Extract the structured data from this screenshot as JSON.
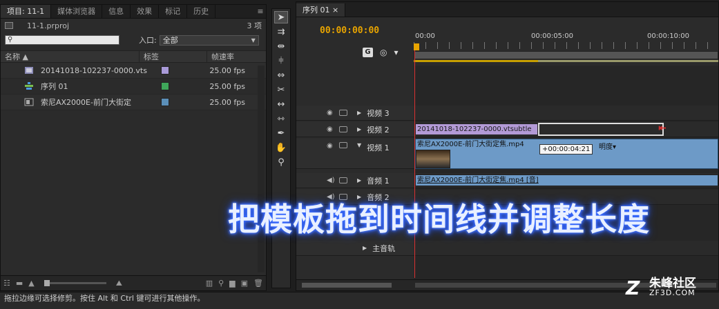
{
  "project_panel": {
    "tabs": [
      "项目: 11-1",
      "媒体浏览器",
      "信息",
      "效果",
      "标记",
      "历史"
    ],
    "file_name": "11-1.prproj",
    "item_count": "3 项",
    "search_placeholder": "",
    "entry_label": "入口:",
    "entry_value": "全部",
    "columns": [
      "名称 ▲",
      "标签",
      "帧速率"
    ],
    "items": [
      {
        "name": "20141018-102237-0000.vts",
        "label_color": "#a99ad8",
        "fps": "25.00 fps",
        "icon": "title-file-icon"
      },
      {
        "name": "序列 01",
        "label_color": "#3fa65a",
        "fps": "25.00 fps",
        "icon": "sequence-icon"
      },
      {
        "name": "索尼AX2000E-前门大街定",
        "label_color": "#5b8fb8",
        "fps": "25.00 fps",
        "icon": "video-clip-icon"
      }
    ]
  },
  "timeline": {
    "tab": "序列 01",
    "timecode": "00:00:00:00",
    "ruler_labels": [
      "00:00",
      "00:00:05:00",
      "00:00:10:00"
    ],
    "tracks": {
      "video3": "视频 3",
      "video2": "视频 2",
      "video1": "视频 1",
      "audio1": "音频 1",
      "audio2": "音频 2",
      "master": "主音轨"
    },
    "clips": {
      "title_clip": "20141018-102237-0000.vtsubtle",
      "video_clip": "索尼AX2000E-前门大街定焦.mp4",
      "opacity": "明度",
      "audio_clip": "索尼AX2000E-前门大街定焦.mp4 [音]"
    },
    "trim_tooltip": "+00:00:04:21"
  },
  "caption": "把模板拖到时间线并调整长度",
  "status_bar": "拖拉边缘可选择修剪。按住 Alt 和 Ctrl 键可进行其他操作。",
  "watermark": {
    "title": "朱峰社区",
    "url": "ZF3D.COM",
    "logo": "Z"
  }
}
